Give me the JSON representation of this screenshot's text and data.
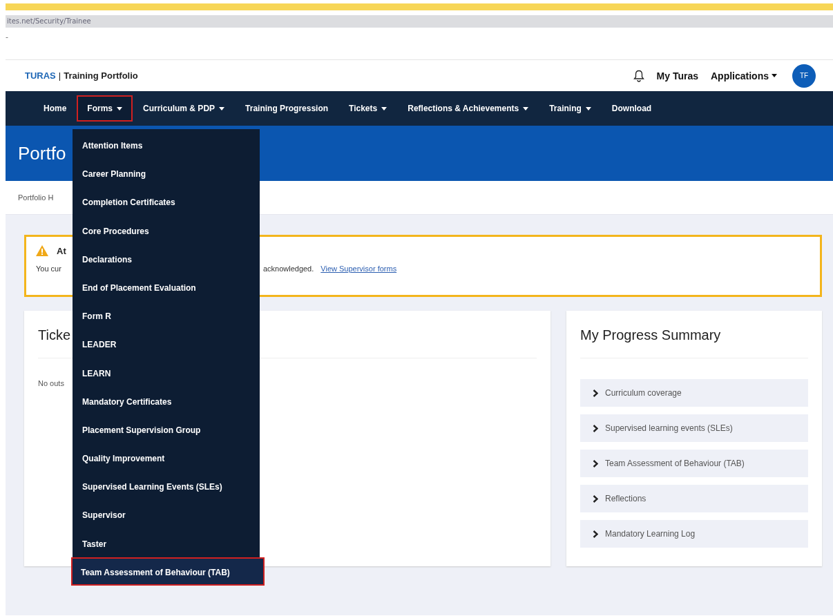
{
  "browser": {
    "address": "ites.net/Security/Trainee",
    "tab_mark": "-"
  },
  "header": {
    "brand": "TURAS",
    "separator": "|",
    "product": "Training Portfolio",
    "links": [
      {
        "label": "My Turas",
        "has_menu": false
      },
      {
        "label": "Applications",
        "has_menu": true
      }
    ],
    "avatar": "TF"
  },
  "nav": [
    {
      "label": "Home",
      "has_menu": false,
      "highlighted": false
    },
    {
      "label": "Forms",
      "has_menu": true,
      "highlighted": true
    },
    {
      "label": "Curriculum & PDP",
      "has_menu": true,
      "highlighted": false
    },
    {
      "label": "Training Progression",
      "has_menu": false,
      "highlighted": false
    },
    {
      "label": "Tickets",
      "has_menu": true,
      "highlighted": false
    },
    {
      "label": "Reflections & Achievements",
      "has_menu": true,
      "highlighted": false
    },
    {
      "label": "Training",
      "has_menu": true,
      "highlighted": false
    },
    {
      "label": "Download",
      "has_menu": false,
      "highlighted": false
    }
  ],
  "forms_menu": [
    {
      "label": "Attention Items",
      "highlighted": false
    },
    {
      "label": "Career Planning",
      "highlighted": false
    },
    {
      "label": "Completion Certificates",
      "highlighted": false
    },
    {
      "label": "Core Procedures",
      "highlighted": false
    },
    {
      "label": "Declarations",
      "highlighted": false
    },
    {
      "label": "End of Placement Evaluation",
      "highlighted": false
    },
    {
      "label": "Form R",
      "highlighted": false
    },
    {
      "label": "LEADER",
      "highlighted": false
    },
    {
      "label": "LEARN",
      "highlighted": false
    },
    {
      "label": "Mandatory Certificates",
      "highlighted": false
    },
    {
      "label": "Placement Supervision Group",
      "highlighted": false
    },
    {
      "label": "Quality Improvement",
      "highlighted": false
    },
    {
      "label": "Supervised Learning Events (SLEs)",
      "highlighted": false
    },
    {
      "label": "Supervisor",
      "highlighted": false
    },
    {
      "label": "Taster",
      "highlighted": false
    },
    {
      "label": "Team Assessment of Behaviour (TAB)",
      "highlighted": true
    }
  ],
  "banner": {
    "title": "Portfo"
  },
  "breadcrumb": "Portfolio H",
  "alert": {
    "title": "At",
    "text_start": "You cur",
    "text_end": "acknowledged.",
    "link": "View Supervisor forms"
  },
  "tickets_card": {
    "title": "Ticke",
    "text": "No outs"
  },
  "progress_card": {
    "title": "My Progress Summary",
    "items": [
      {
        "label": "Curriculum coverage",
        "expanded": false
      },
      {
        "label": "Supervised learning events (SLEs)",
        "expanded": false
      },
      {
        "label": "Team Assessment of Behaviour (TAB)",
        "expanded": false
      },
      {
        "label": "Reflections",
        "expanded": false
      },
      {
        "label": "Mandatory Learning Log",
        "expanded": false
      }
    ]
  }
}
